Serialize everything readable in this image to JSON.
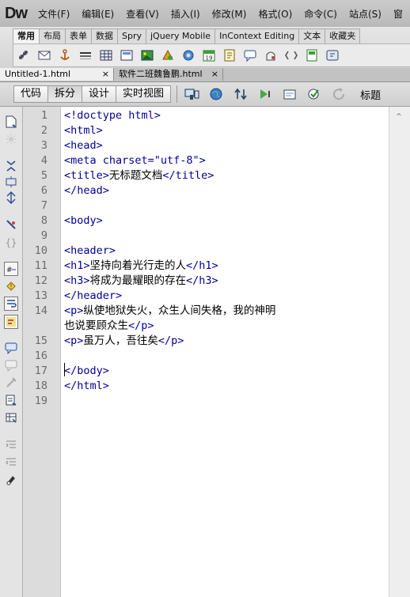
{
  "app": {
    "logo": "Dw"
  },
  "menu": [
    "文件(F)",
    "编辑(E)",
    "查看(V)",
    "插入(I)",
    "修改(M)",
    "格式(O)",
    "命令(C)",
    "站点(S)",
    "窗"
  ],
  "insert_tabs": [
    "常用",
    "布局",
    "表单",
    "数据",
    "Spry",
    "jQuery Mobile",
    "InContext Editing",
    "文本",
    "收藏夹"
  ],
  "insert_icons": [
    "hyperlink-icon",
    "email-link-icon",
    "named-anchor-icon",
    "horizontal-rule-icon",
    "table-icon",
    "insert-div-icon",
    "image-icon",
    "media-icon",
    "widget-icon",
    "date-icon",
    "server-include-icon",
    "comment-icon",
    "head-icon",
    "script-icon",
    "templates-icon",
    "tag-chooser-icon"
  ],
  "doc_tabs": [
    {
      "name": "Untitled-1.html",
      "close": "×"
    },
    {
      "name": "软件二班魏鲁鹏.html",
      "close": "×"
    }
  ],
  "view_buttons": [
    "代码",
    "拆分",
    "设计",
    "实时视图"
  ],
  "view_title": "标题",
  "line_numbers": [
    "1",
    "2",
    "3",
    "4",
    "5",
    "6",
    "7",
    "8",
    "9",
    "10",
    "11",
    "12",
    "13",
    "14",
    "",
    "15",
    "16",
    "17",
    "18",
    "19"
  ],
  "code_lines": [
    {
      "tag": "<!doctype html>",
      "text": "",
      "tag2": ""
    },
    {
      "tag": "<html>",
      "text": "",
      "tag2": ""
    },
    {
      "tag": "<head>",
      "text": "",
      "tag2": ""
    },
    {
      "tag": "<meta charset=\"utf-8\">",
      "text": "",
      "tag2": ""
    },
    {
      "tag": "<title>",
      "text": "无标题文档",
      "tag2": "</title>"
    },
    {
      "tag": "</head>",
      "text": "",
      "tag2": ""
    },
    {
      "tag": "",
      "text": "",
      "tag2": ""
    },
    {
      "tag": "<body>",
      "text": "",
      "tag2": ""
    },
    {
      "tag": "",
      "text": "",
      "tag2": ""
    },
    {
      "tag": "<header>",
      "text": "",
      "tag2": ""
    },
    {
      "tag": "<h1>",
      "text": "坚持向着光行走的人",
      "tag2": "</h1>"
    },
    {
      "tag": "<h3>",
      "text": "将成为最耀眼的存在",
      "tag2": "</h3>"
    },
    {
      "tag": "</header>",
      "text": "",
      "tag2": ""
    },
    {
      "tag": "<p>",
      "text": "纵使地狱失火，众生人间失格，我的神明",
      "tag2": ""
    },
    {
      "tag": "",
      "text": "也说要顾众生",
      "tag2": "</p>"
    },
    {
      "tag": "<p>",
      "text": "虽万人，吾往矣",
      "tag2": "</p>"
    },
    {
      "tag": "",
      "text": "",
      "tag2": ""
    },
    {
      "tag": "</body>",
      "text": "",
      "tag2": ""
    },
    {
      "tag": "</html>",
      "text": "",
      "tag2": ""
    },
    {
      "tag": "",
      "text": "",
      "tag2": ""
    }
  ]
}
